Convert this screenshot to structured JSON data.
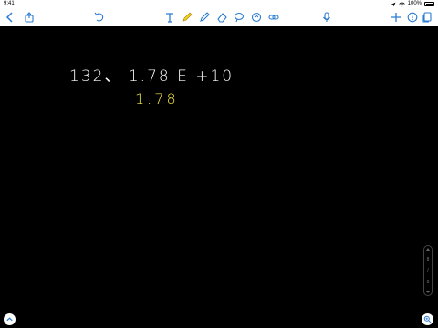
{
  "status_bar": {
    "time": "9:41",
    "battery": "100%"
  },
  "toolbar": {
    "icons": [
      "back-chevron-icon",
      "share-icon",
      "undo-icon",
      "text-tool-icon",
      "pen-tool-icon",
      "highlighter-tool-icon",
      "eraser-tool-icon",
      "lasso-tool-icon",
      "shape-tool-icon",
      "link-tool-icon",
      "microphone-icon",
      "add-page-icon",
      "settings-icon",
      "pages-icon"
    ],
    "accent_color": "#2b7cd3"
  },
  "canvas": {
    "background": "#000000",
    "line1": "132、  1.78 E +10",
    "line2": "1.78",
    "line2_color": "#f4e842"
  },
  "page_indicator": {
    "current": "8",
    "total": "9"
  }
}
